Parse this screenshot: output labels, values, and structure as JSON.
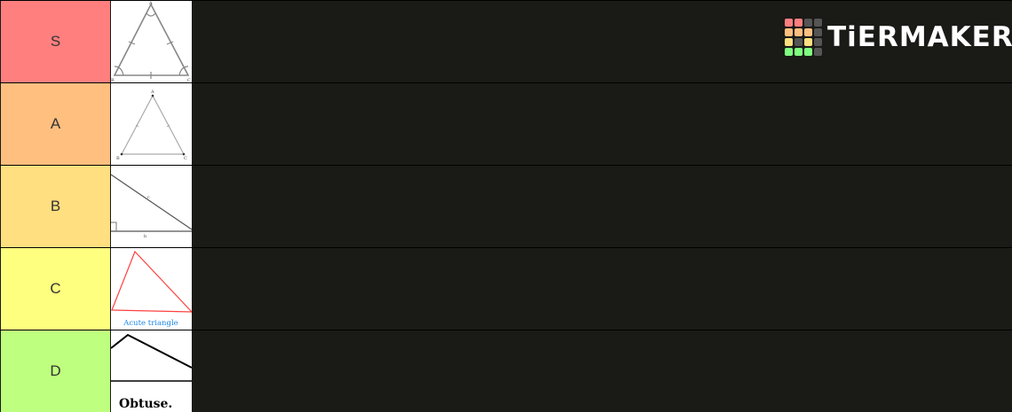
{
  "app": {
    "brand": "TiERMAKER"
  },
  "tiers": [
    {
      "label": "S",
      "color": "#ff7f7f"
    },
    {
      "label": "A",
      "color": "#ffbf7f"
    },
    {
      "label": "B",
      "color": "#ffdf7f"
    },
    {
      "label": "C",
      "color": "#ffff7f"
    },
    {
      "label": "D",
      "color": "#bfff7f"
    }
  ],
  "items": {
    "equilateral_marked": {
      "icon": "equilateral-triangle-with-angle-marks"
    },
    "equilateral_labeled": {
      "icon": "equilateral-triangle-labeled",
      "vertex_labels": [
        "A",
        "B",
        "C"
      ]
    },
    "right_triangle": {
      "icon": "right-triangle",
      "side_labels": [
        "c",
        "b"
      ]
    },
    "acute_triangle": {
      "icon": "acute-triangle",
      "caption": "Acute triangle",
      "stroke_color": "#ff4040",
      "caption_color": "#1e88e5"
    },
    "obtuse_triangle": {
      "icon": "obtuse-triangle",
      "caption": "Obtuse."
    }
  },
  "logo_colors": {
    "row1": [
      "#ff7f7f",
      "#ff7f7f",
      "#555555",
      "#555555"
    ],
    "row2": [
      "#ffbf7f",
      "#ffbf7f",
      "#ffbf7f",
      "#555555"
    ],
    "row3": [
      "#ffdf7f",
      "#555555",
      "#ffdf7f",
      "#555555"
    ],
    "row4": [
      "#7fff7f",
      "#7fff7f",
      "#7fff7f",
      "#555555"
    ]
  }
}
